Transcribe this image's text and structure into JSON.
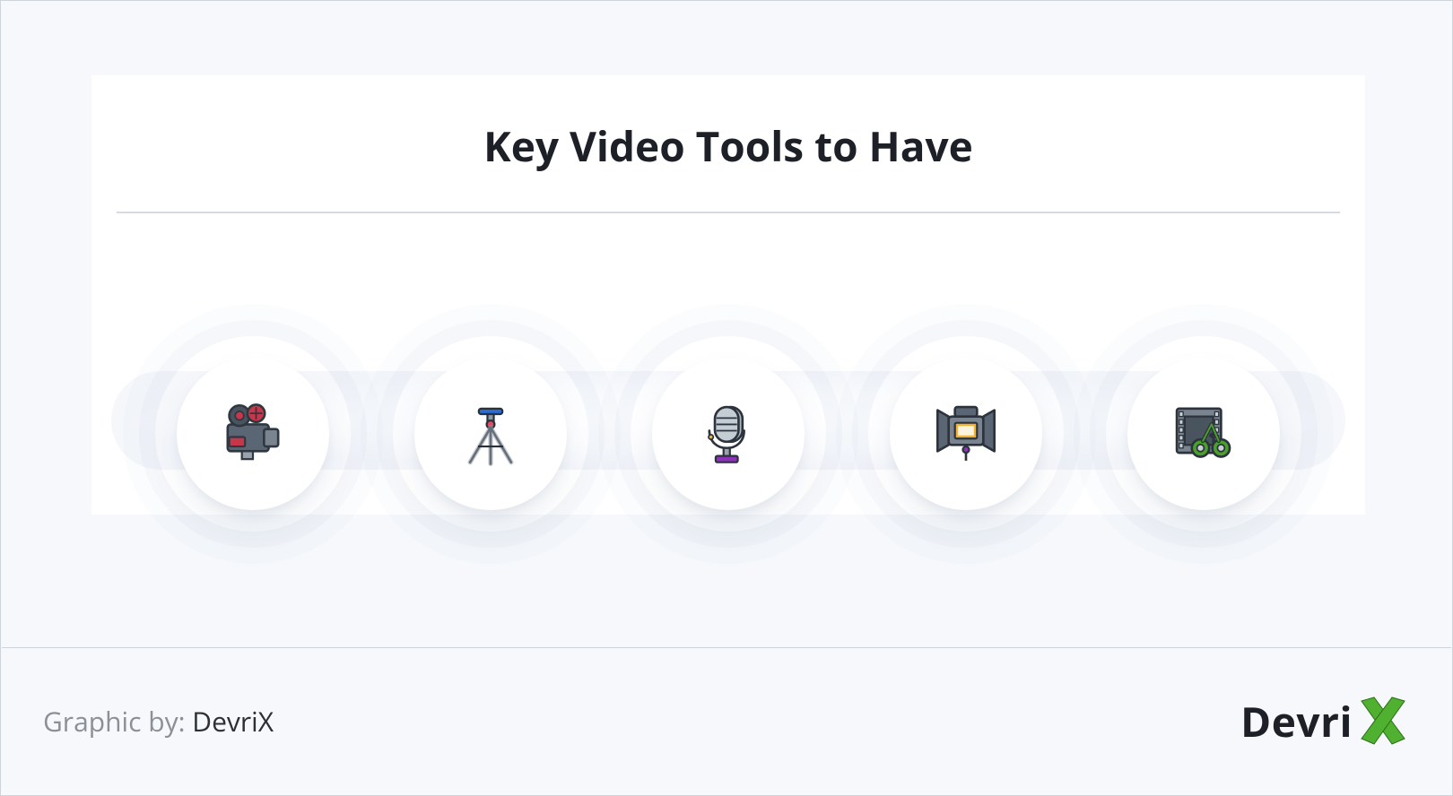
{
  "title": "Key Video Tools to Have",
  "icons": [
    {
      "name": "video-camera-icon"
    },
    {
      "name": "tripod-icon"
    },
    {
      "name": "microphone-icon"
    },
    {
      "name": "studio-light-icon"
    },
    {
      "name": "film-editing-icon"
    }
  ],
  "footer": {
    "credit_label": "Graphic by: ",
    "credit_name": "DevriX",
    "logo_text": "Devri"
  },
  "colors": {
    "page_bg": "#f6f8fb",
    "card_bg": "#ffffff",
    "border": "#cfd4db",
    "rule": "#d6dae4",
    "text": "#1d2127",
    "muted": "#8b8f96",
    "brand_green": "#4fb12f"
  }
}
